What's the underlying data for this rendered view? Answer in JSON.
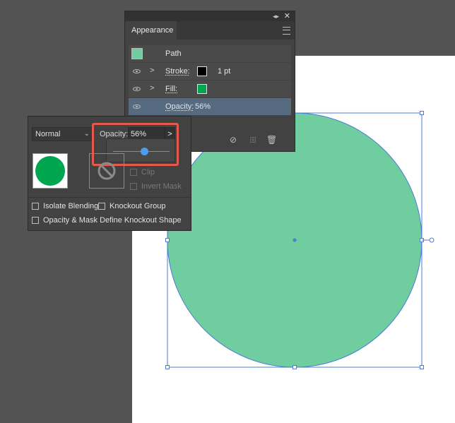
{
  "appearance_panel": {
    "tab_title": "Appearance",
    "path_label": "Path",
    "stroke": {
      "label": "Stroke:",
      "weight": "1 pt",
      "color": "#000000"
    },
    "fill": {
      "label": "Fill:",
      "color": "#00a550"
    },
    "opacity_row": {
      "label": "Opacity:",
      "value": "56%"
    },
    "object_swatch_color": "#6fcd9f"
  },
  "transparency_panel": {
    "blend_mode": "Normal",
    "opacity_label": "Opacity:",
    "opacity_value": "56%",
    "opacity_percent": 56,
    "clip_label": "Clip",
    "invert_mask_label": "Invert Mask",
    "isolate_blending_label": "Isolate Blending",
    "knockout_group_label": "Knockout Group",
    "opacity_mask_label": "Opacity & Mask Define Knockout Shape",
    "thumbnail_color": "#00a550"
  },
  "canvas": {
    "circle_fill": "#6fcd9f",
    "selection_color": "#4a7cd8"
  }
}
